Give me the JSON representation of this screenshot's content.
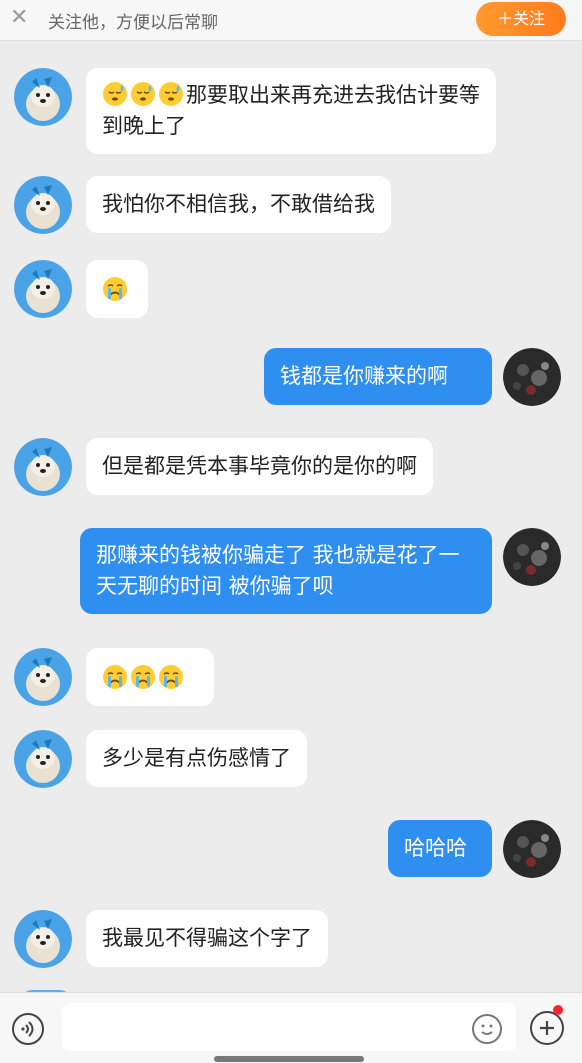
{
  "header": {
    "follow_tip": "关注他，方便以后常聊",
    "follow_button": "＋关注"
  },
  "messages": [
    {
      "side": "in",
      "emoji": [
        "sweat",
        "sweat",
        "sweat"
      ],
      "text": "那要取出来再充进去我估计要等到晚上了"
    },
    {
      "side": "in",
      "text": "我怕你不相信我，不敢借给我"
    },
    {
      "side": "in",
      "emoji": [
        "cry"
      ],
      "text": ""
    },
    {
      "side": "out",
      "text": "钱都是你赚来的啊"
    },
    {
      "side": "in",
      "text": "但是都是凭本事毕竟你的是你的啊"
    },
    {
      "side": "out",
      "text": "那赚来的钱被你骗走了 我也就是花了一天无聊的时间 被你骗了呗"
    },
    {
      "side": "in",
      "emoji": [
        "cry",
        "cry",
        "cry"
      ],
      "text": ""
    },
    {
      "side": "in",
      "text": "多少是有点伤感情了"
    },
    {
      "side": "out",
      "text": "哈哈哈"
    },
    {
      "side": "in",
      "text": "我最见不得骗这个字了"
    }
  ],
  "colors": {
    "incoming_bubble": "#ffffff",
    "outgoing_bubble": "#2f8ff0",
    "follow_button": "#ff8a24",
    "background": "#ececec"
  },
  "icons": {
    "close": "close-icon",
    "voice": "voice-icon",
    "emoji": "emoji-icon",
    "plus": "plus-icon"
  }
}
